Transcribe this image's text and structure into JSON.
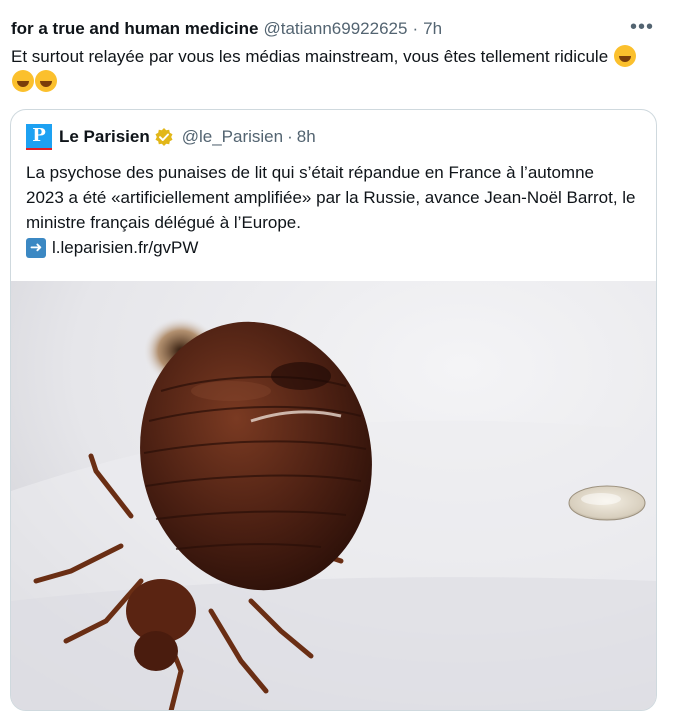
{
  "tweet": {
    "author_name": "for a true and human medicine",
    "handle": "@tatiann69922625",
    "separator": "·",
    "time": "7h",
    "more_label": "•••",
    "text": "Et surtout relayée par vous les médias mainstream, vous êtes tellement ridicule",
    "emoji_count": 3,
    "emoji_name": "face-with-tears-of-joy"
  },
  "quote": {
    "logo_letter": "P",
    "author_name": "Le Parisien",
    "verified": "gold-verified-badge",
    "handle": "@le_Parisien",
    "separator": "·",
    "time": "8h",
    "text": "La psychose des punaises de lit qui s’était répandue en France à l’automne 2023 a été «artificiellement amplifiée» par la Russie, avance Jean-Noël Barrot, le ministre français délégué à l’Europe.",
    "link_icon": "right-arrow-icon",
    "link_text": "l.leparisien.fr/gvPW",
    "media_description_icon": "bedbug-photo"
  },
  "colors": {
    "text": "#0f1419",
    "secondary": "#536471",
    "border": "#cfd9de",
    "logo_blue": "#1da1f2",
    "logo_red": "#e31e24",
    "verified_gold": "#e2b719"
  }
}
